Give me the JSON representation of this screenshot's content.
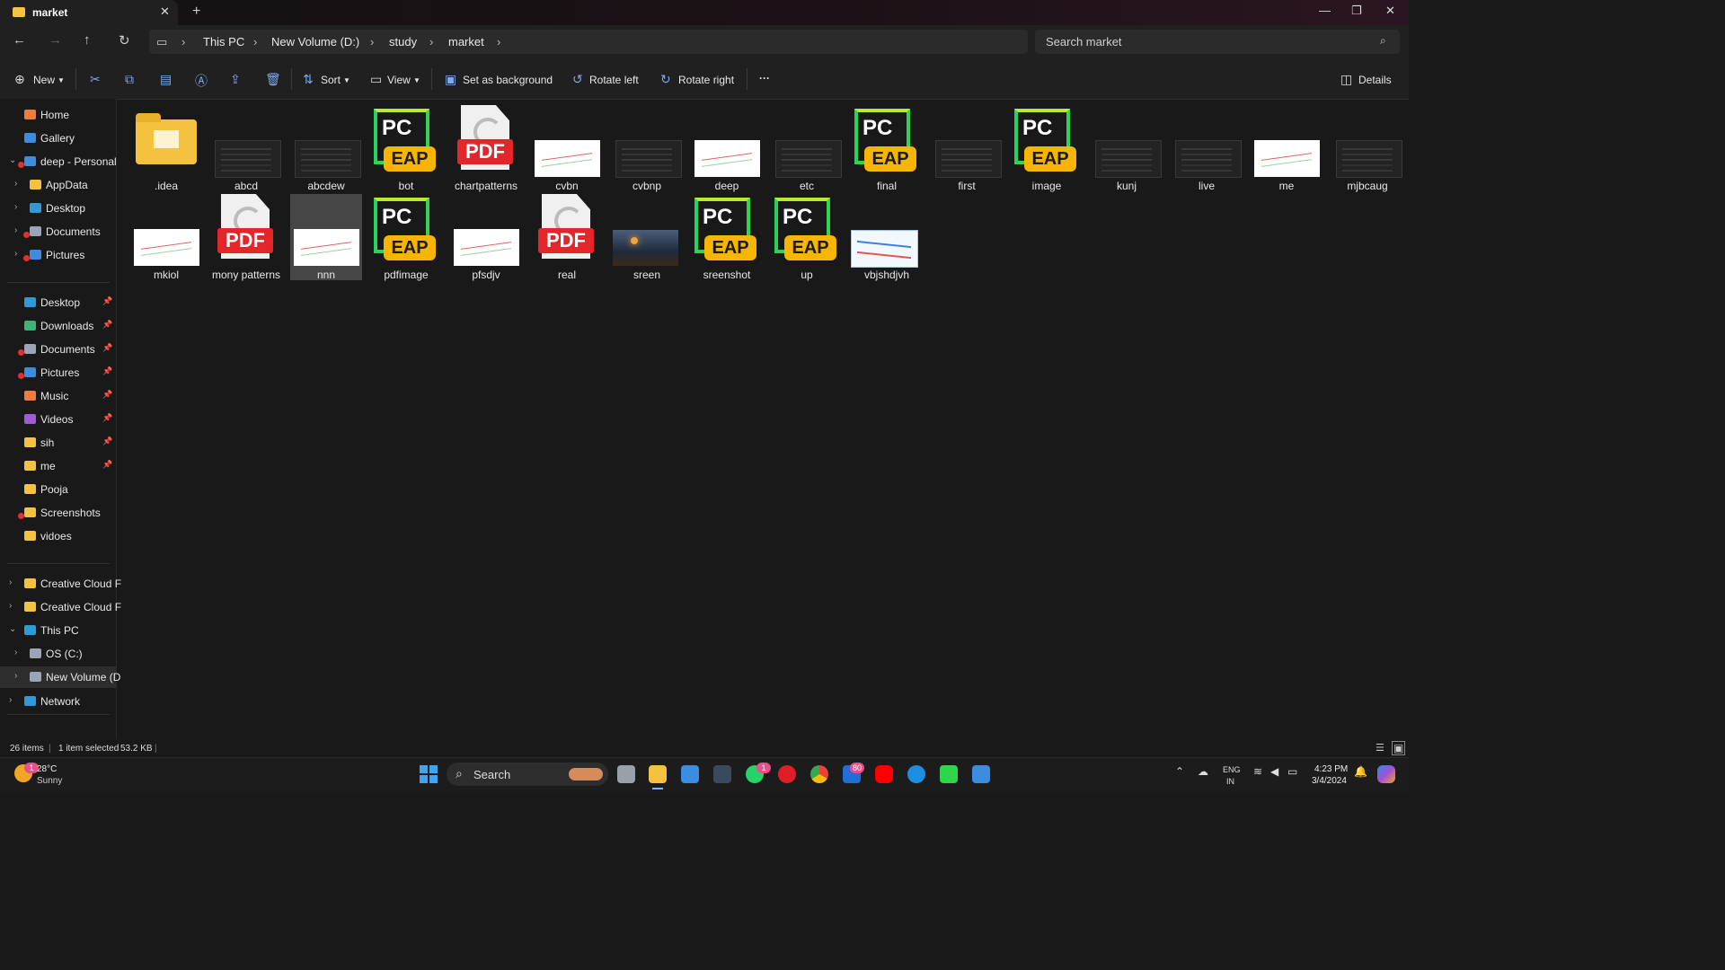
{
  "window": {
    "tab_title": "market",
    "tab_close": "✕",
    "new_tab": "+",
    "minimize": "—",
    "maximize": "❐",
    "close": "✕"
  },
  "address": {
    "breadcrumb": [
      "This PC",
      "New Volume (D:)",
      "study",
      "market"
    ],
    "search_placeholder": "Search market"
  },
  "toolbar": {
    "new_label": "New",
    "sort_label": "Sort",
    "view_label": "View",
    "set_background_label": "Set as background",
    "rotate_left_label": "Rotate left",
    "rotate_right_label": "Rotate right",
    "more_label": "···",
    "details_label": "Details"
  },
  "sidebar": {
    "items": [
      {
        "label": "Home",
        "icon": "home-icon",
        "color": "#f07c3a"
      },
      {
        "label": "Gallery",
        "icon": "gallery-icon",
        "color": "#3c8de0"
      },
      {
        "label": "deep - Personal",
        "icon": "cloud-icon",
        "color": "#3c8de0"
      },
      {
        "label": "AppData",
        "icon": "folder-icon",
        "color": "#f4c23f"
      },
      {
        "label": "Desktop",
        "icon": "desktop-icon",
        "color": "#2f9ad8"
      },
      {
        "label": "Documents",
        "icon": "documents-icon",
        "color": "#9aa6b8"
      },
      {
        "label": "Pictures",
        "icon": "pictures-icon",
        "color": "#3c8de0"
      },
      {
        "label": "Desktop",
        "icon": "desktop-icon",
        "color": "#2f9ad8"
      },
      {
        "label": "Downloads",
        "icon": "download-icon",
        "color": "#3cb37a"
      },
      {
        "label": "Documents",
        "icon": "documents-icon",
        "color": "#9aa6b8"
      },
      {
        "label": "Pictures",
        "icon": "pictures-icon",
        "color": "#3c8de0"
      },
      {
        "label": "Music",
        "icon": "music-icon",
        "color": "#f07c3a"
      },
      {
        "label": "Videos",
        "icon": "videos-icon",
        "color": "#a05ad6"
      },
      {
        "label": "sih",
        "icon": "folder-icon",
        "color": "#f4c23f"
      },
      {
        "label": "me",
        "icon": "folder-icon",
        "color": "#f4c23f"
      },
      {
        "label": "Pooja",
        "icon": "folder-icon",
        "color": "#f4c23f"
      },
      {
        "label": "Screenshots",
        "icon": "folder-icon",
        "color": "#f4c23f"
      },
      {
        "label": "vidoes",
        "icon": "folder-icon",
        "color": "#f4c23f"
      },
      {
        "label": "Creative Cloud F",
        "icon": "folder-icon",
        "color": "#f4c23f"
      },
      {
        "label": "Creative Cloud F",
        "icon": "folder-icon",
        "color": "#f4c23f"
      },
      {
        "label": "This PC",
        "icon": "pc-icon",
        "color": "#2f9ad8"
      },
      {
        "label": "OS (C:)",
        "icon": "drive-icon",
        "color": "#9aa6b8"
      },
      {
        "label": "New Volume (D",
        "icon": "drive-icon",
        "color": "#9aa6b8"
      },
      {
        "label": "Network",
        "icon": "network-icon",
        "color": "#2f9ad8"
      }
    ]
  },
  "files": [
    {
      "name": ".idea",
      "kind": "folder"
    },
    {
      "name": "abcd",
      "kind": "dark"
    },
    {
      "name": "abcdew",
      "kind": "dark"
    },
    {
      "name": "bot",
      "kind": "pycharm"
    },
    {
      "name": "chartpatterns",
      "kind": "pdf"
    },
    {
      "name": "cvbn",
      "kind": "white"
    },
    {
      "name": "cvbnp",
      "kind": "dark"
    },
    {
      "name": "deep",
      "kind": "white"
    },
    {
      "name": "etc",
      "kind": "dark"
    },
    {
      "name": "final",
      "kind": "pycharm"
    },
    {
      "name": "first",
      "kind": "dark"
    },
    {
      "name": "image",
      "kind": "pycharm"
    },
    {
      "name": "kunj",
      "kind": "dark"
    },
    {
      "name": "live",
      "kind": "dark"
    },
    {
      "name": "me",
      "kind": "white"
    },
    {
      "name": "mjbcaug",
      "kind": "dark"
    },
    {
      "name": "mkiol",
      "kind": "white"
    },
    {
      "name": "mony patterns",
      "kind": "pdf"
    },
    {
      "name": "nnn",
      "kind": "white",
      "selected": true
    },
    {
      "name": "pdfimage",
      "kind": "pycharm"
    },
    {
      "name": "pfsdjv",
      "kind": "white"
    },
    {
      "name": "real",
      "kind": "pdf"
    },
    {
      "name": "sreen",
      "kind": "photo"
    },
    {
      "name": "sreenshot",
      "kind": "pycharm"
    },
    {
      "name": "up",
      "kind": "pycharm"
    },
    {
      "name": "vbjshdjvh",
      "kind": "blue"
    }
  ],
  "icon_text": {
    "pc": "PC",
    "eap": "EAP",
    "pdf": "PDF"
  },
  "status": {
    "items": "26 items",
    "selected": "1 item selected",
    "size": "53.2 KB"
  },
  "taskbar": {
    "weather_temp": "28°C",
    "weather_desc": "Sunny",
    "weather_badge": "1",
    "search_label": "Search",
    "whatsapp_badge": "1",
    "mail_badge": "80",
    "lang": "ENG",
    "region": "IN",
    "time": "4:23 PM",
    "date": "3/4/2024"
  }
}
